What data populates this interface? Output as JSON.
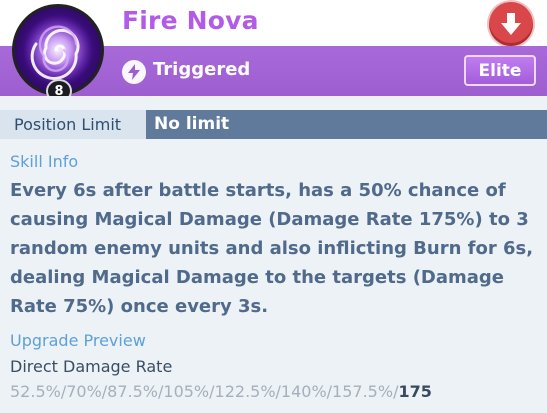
{
  "skill": {
    "name": "Fire Nova",
    "level": "8",
    "trigger_type": "Triggered",
    "rarity": "Elite",
    "icon": "purple-vortex-icon"
  },
  "position_limit": {
    "label": "Position Limit",
    "value": "No limit"
  },
  "skill_info": {
    "title": "Skill Info",
    "description": "Every 6s after battle starts, has a 50% chance of causing Magical Damage (Damage Rate 175%) to 3 random enemy units and also inflicting Burn for 6s, dealing Magical Damage to the targets (Damage Rate 75%) once every 3s."
  },
  "upgrade_preview": {
    "title": "Upgrade Preview",
    "stat_name": "Direct Damage Rate",
    "values": "52.5%/70%/87.5%/105%/122.5%/140%/157.5%/",
    "current": "175"
  },
  "colors": {
    "accent_purple": "#a86ad9",
    "title_purple": "#b15be8",
    "panel_bg": "#edf2f6",
    "limit_bar": "#5f7a9a",
    "downgrade_red": "#d9474a"
  }
}
